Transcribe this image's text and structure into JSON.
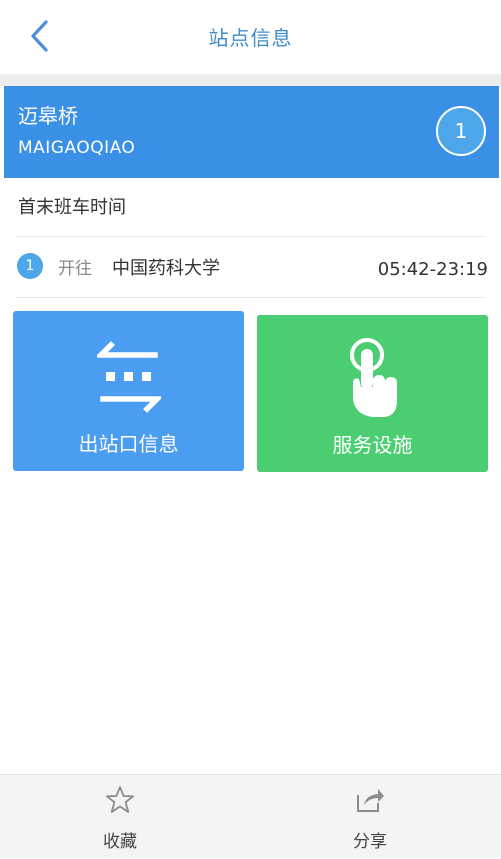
{
  "nav": {
    "title": "站点信息",
    "back_icon": "chevron-left-icon"
  },
  "station": {
    "name": "迈皋桥",
    "pinyin": "MAIGAOQIAO",
    "line_number": "1",
    "header_color": "#3a8fe6"
  },
  "schedule": {
    "section_title": "首末班车时间",
    "rows": [
      {
        "line_number": "1",
        "direction_label": "开往",
        "destination": "中国药科大学",
        "hours": "05:42-23:19"
      }
    ]
  },
  "tiles": {
    "exit_info": {
      "label": "出站口信息",
      "icon": "exit-arrows-icon",
      "color": "#4a9df0"
    },
    "service": {
      "label": "服务设施",
      "icon": "tap-hand-icon",
      "color": "#4bcd72"
    }
  },
  "tab_bar": {
    "favorite_label": "收藏",
    "favorite_icon": "star-outline-icon",
    "share_label": "分享",
    "share_icon": "share-icon"
  },
  "colors": {
    "accent": "#3f8cc9",
    "badge": "#4ea6ea"
  }
}
